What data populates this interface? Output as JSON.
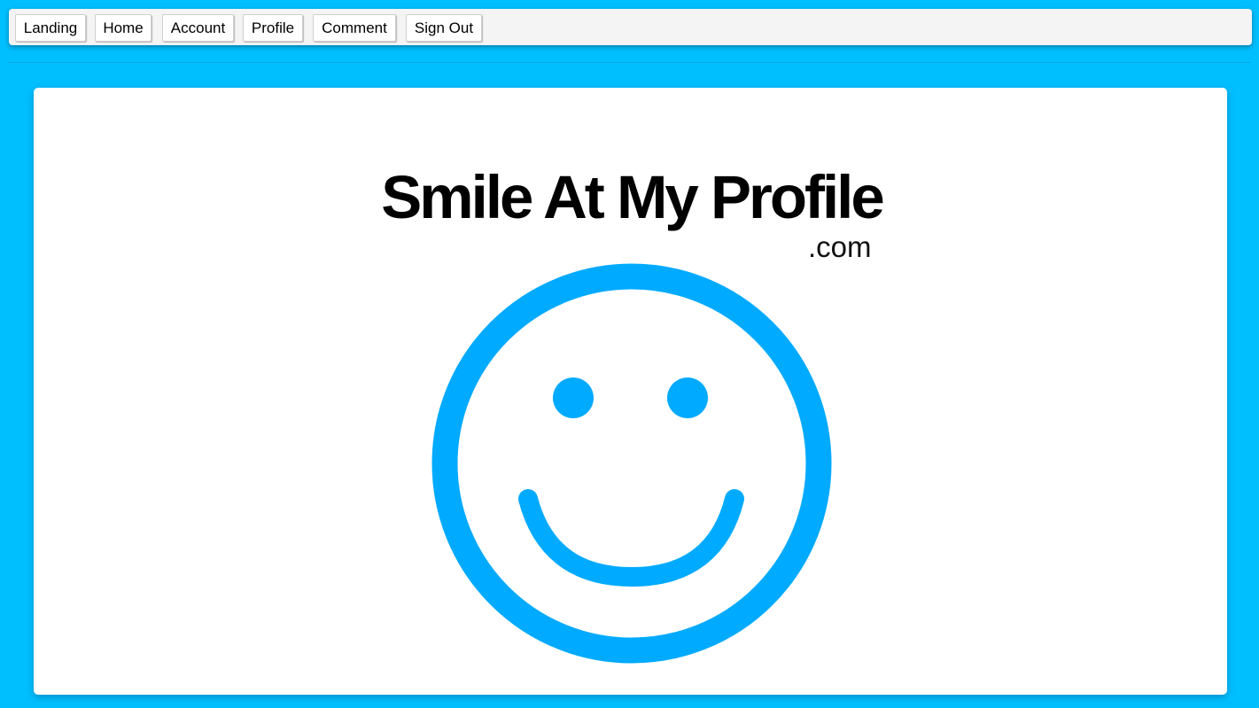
{
  "nav": {
    "items": [
      {
        "label": "Landing"
      },
      {
        "label": "Home"
      },
      {
        "label": "Account"
      },
      {
        "label": "Profile"
      },
      {
        "label": "Comment"
      },
      {
        "label": "Sign Out"
      }
    ]
  },
  "logo": {
    "title": "Smile At My Profile",
    "suffix": ".com",
    "icon": "smiley-face-icon",
    "color": "#00aaff"
  },
  "colors": {
    "background": "#00bfff",
    "navbar": "#f4f4f4",
    "card": "#ffffff"
  }
}
